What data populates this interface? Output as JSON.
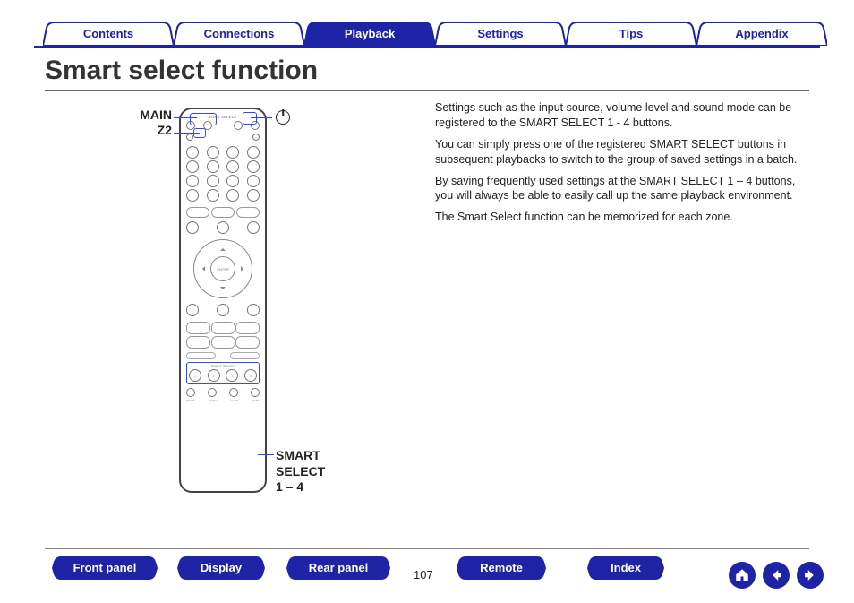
{
  "tabs": [
    {
      "label": "Contents",
      "active": false
    },
    {
      "label": "Connections",
      "active": false
    },
    {
      "label": "Playback",
      "active": true
    },
    {
      "label": "Settings",
      "active": false
    },
    {
      "label": "Tips",
      "active": false
    },
    {
      "label": "Appendix",
      "active": false
    }
  ],
  "title": "Smart select function",
  "callouts": {
    "main": "MAIN",
    "z2": "Z2",
    "smart": "SMART\nSELECT\n1 – 4"
  },
  "body": {
    "p1": "Settings such as the input source, volume level and sound mode can be registered to the SMART SELECT 1 - 4 buttons.",
    "p2": "You can simply press one of the registered SMART SELECT buttons in subsequent playbacks to switch to the group of saved settings in a batch.",
    "p3": "By saving frequently used settings at the SMART SELECT 1 – 4 buttons, you will always be able to easily call up the same playback environment.",
    "p4": "The Smart Select function can be memorized for each zone."
  },
  "bottom": {
    "front": "Front panel",
    "display": "Display",
    "rear": "Rear panel",
    "remote": "Remote",
    "index": "Index"
  },
  "page_number": "107"
}
